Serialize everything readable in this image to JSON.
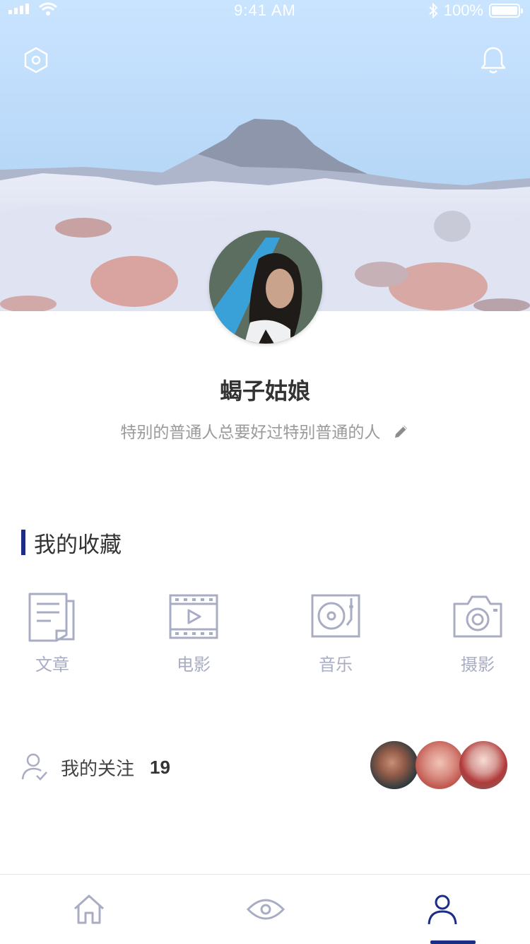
{
  "status_bar": {
    "time": "9:41 AM",
    "battery": "100%"
  },
  "header": {
    "settings_icon": "settings-hex-icon",
    "notification_icon": "bell-icon"
  },
  "profile": {
    "name": "蝎子姑娘",
    "bio": "特别的普通人总要好过特别普通的人",
    "edit_icon": "pencil-icon"
  },
  "collections": {
    "title": "我的收藏",
    "accent_color": "#1c2d88",
    "items": [
      {
        "label": "文章",
        "icon": "article-icon"
      },
      {
        "label": "电影",
        "icon": "film-icon"
      },
      {
        "label": "音乐",
        "icon": "turntable-icon"
      },
      {
        "label": "摄影",
        "icon": "camera-icon"
      }
    ]
  },
  "following": {
    "label": "我的关注",
    "count": "19"
  },
  "tab_bar": {
    "items": [
      {
        "icon": "home-icon",
        "active": false
      },
      {
        "icon": "eye-icon",
        "active": false
      },
      {
        "icon": "user-icon",
        "active": true
      }
    ]
  }
}
